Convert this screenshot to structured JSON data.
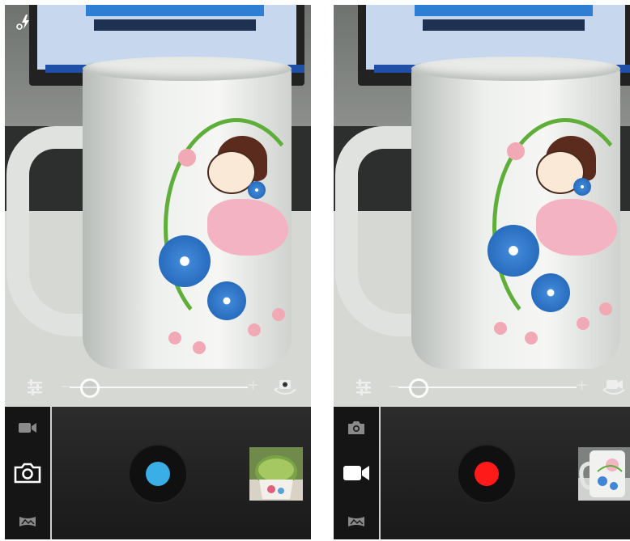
{
  "panels": [
    {
      "id": "photo-mode",
      "zoom": {
        "level": 0.1,
        "minus_label": "−",
        "plus_label": "+"
      },
      "flash": {
        "visible": true
      },
      "modes": [
        {
          "name": "video",
          "active": false,
          "icon": "video-camera-icon"
        },
        {
          "name": "photo",
          "active": true,
          "icon": "camera-icon"
        },
        {
          "name": "panorama",
          "active": false,
          "icon": "panorama-icon"
        }
      ],
      "shutter": {
        "color": "#3aaee6",
        "icon": "shutter-button"
      },
      "thumbnail": {
        "subject": "cactus-photo"
      }
    },
    {
      "id": "video-mode",
      "zoom": {
        "level": 0.1,
        "minus_label": "−",
        "plus_label": "+"
      },
      "flash": {
        "visible": false
      },
      "modes": [
        {
          "name": "photo",
          "active": false,
          "icon": "camera-icon"
        },
        {
          "name": "video",
          "active": true,
          "icon": "video-camera-icon"
        },
        {
          "name": "panorama",
          "active": false,
          "icon": "panorama-icon"
        }
      ],
      "shutter": {
        "color": "#ff1a1a",
        "icon": "record-button"
      },
      "thumbnail": {
        "subject": "mug-photo"
      }
    }
  ],
  "colors": {
    "photo_shutter": "#3aaee6",
    "video_shutter": "#ff1a1a",
    "bar_bg": "#1d1d1d"
  }
}
